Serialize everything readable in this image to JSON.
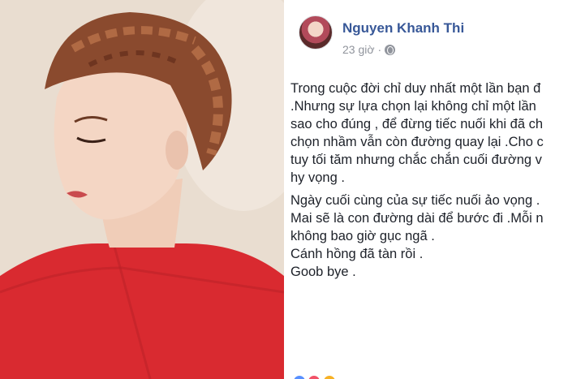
{
  "post": {
    "author": "Nguyen Khanh Thi",
    "time": "23 giờ",
    "privacy_icon": "globe-icon",
    "lines": [
      "Trong cuộc đời chỉ duy nhất một lần bạn đ",
      ".Nhưng sự lựa chọn lại không chỉ một lần",
      "sao cho đúng , để đừng tiếc nuối khi đã ch",
      "chọn nhầm vẫn còn đường quay lại .Cho c",
      "tuy tối tăm nhưng chắc chắn cuối đường v",
      "hy vọng .",
      "Ngày cuối cùng của sự tiếc nuối ảo vọng .",
      "Mai sẽ là con đường dài để bước đi .Mỗi n",
      "không bao giờ gục ngã .",
      "Cánh hồng đã tàn rồi .",
      "Goob bye ."
    ]
  },
  "colors": {
    "author_link": "#385898",
    "meta_gray": "#90949c",
    "dress_red": "#d92a30"
  }
}
